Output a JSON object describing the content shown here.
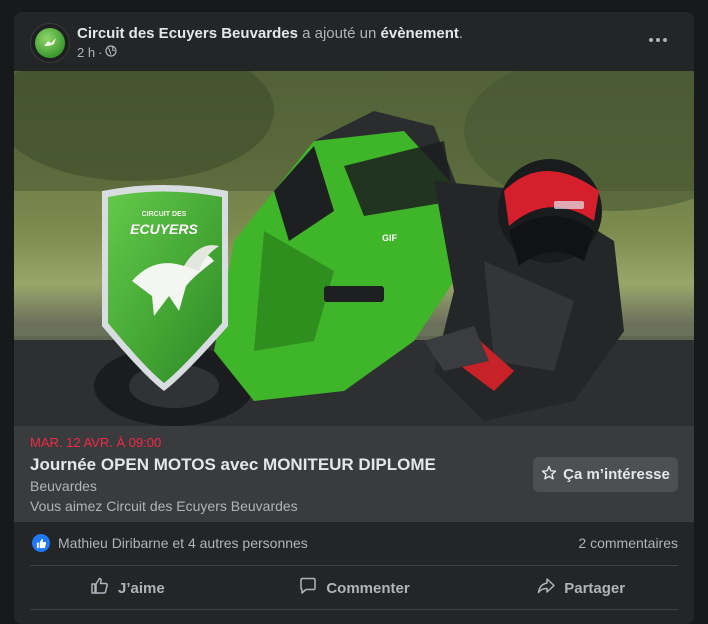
{
  "post": {
    "page_name": "Circuit des Ecuyers Beuvardes",
    "action_text": " a ajouté un ",
    "object_text": "évènement",
    "period": ".",
    "time": "2 h",
    "separator": "·",
    "privacy_icon": "globe-icon",
    "more_icon": "more-options-icon"
  },
  "image": {
    "logo_top_text": "CIRCUIT DES",
    "logo_main_text": "ECUYERS",
    "bike_numbers": "GIF",
    "colors": {
      "bike_green": "#3fb52a",
      "helmet_red": "#d61f2c",
      "track": "#2b2d2e",
      "grass": "#8a9a5a"
    }
  },
  "event": {
    "date": "MAR. 12 AVR. À 09:00",
    "title": "Journée OPEN MOTOS avec MONITEUR DIPLOME",
    "location": "Beuvardes",
    "friends_text": "Vous aimez Circuit des Ecuyers Beuvardes",
    "interest_button": "Ça m’intéresse",
    "interest_icon": "star-icon"
  },
  "reactions": {
    "reaction_icon": "like-icon",
    "names": "Mathieu Diribarne et 4 autres personnes",
    "comments": "2 commentaires"
  },
  "actions": {
    "like": "J’aime",
    "comment": "Commenter",
    "share": "Partager"
  },
  "colors": {
    "background": "#18191a",
    "card": "#242526",
    "event_panel": "#3a3b3c",
    "date_red": "#f0284a",
    "like_blue": "#2078f4"
  }
}
